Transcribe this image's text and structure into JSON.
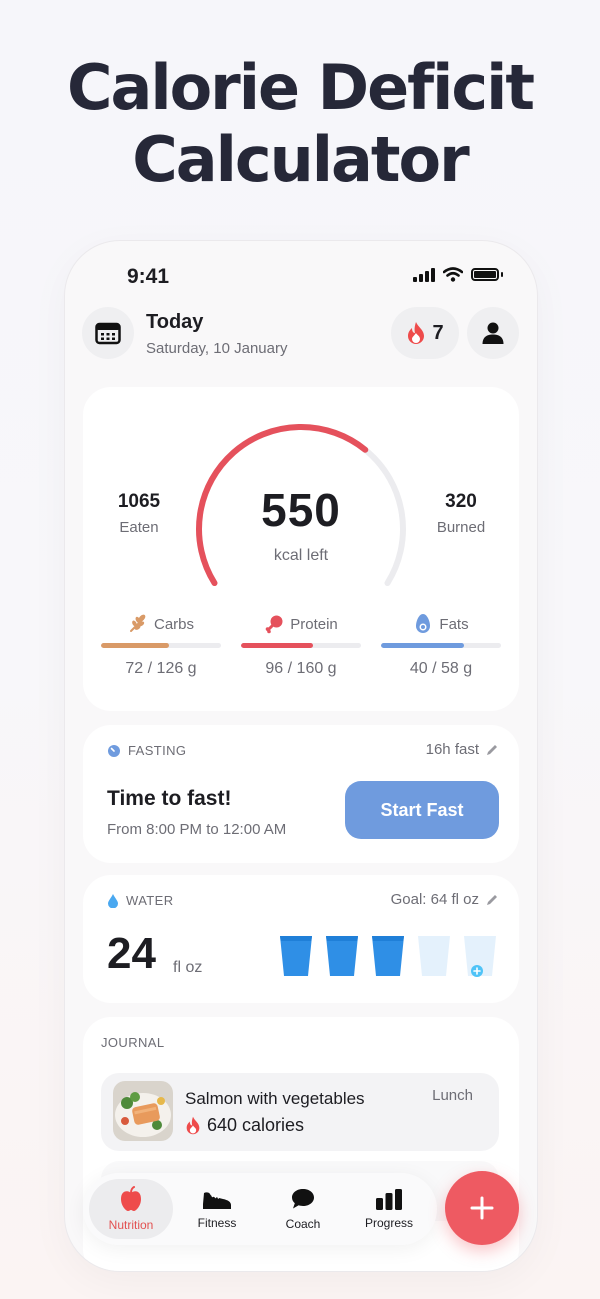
{
  "headline": {
    "line1": "Calorie Deficit",
    "line2": "Calculator"
  },
  "status_bar": {
    "time": "9:41"
  },
  "header": {
    "title": "Today",
    "date": "Saturday, 10 January",
    "streak_count": "7",
    "calendar_icon": "calendar-icon",
    "profile_icon": "user-icon"
  },
  "summary": {
    "eaten_value": "1065",
    "eaten_label": "Eaten",
    "kcal_left": "550",
    "kcal_left_label": "kcal left",
    "burned_value": "320",
    "burned_label": "Burned",
    "ring_progress": 0.66,
    "ring_color": "#e5515c",
    "macros": [
      {
        "name": "Carbs",
        "value": "72 / 126 g",
        "progress": 0.57,
        "color": "#d99a67",
        "icon": "wheat-icon"
      },
      {
        "name": "Protein",
        "value": "96 / 160 g",
        "progress": 0.6,
        "color": "#e5515c",
        "icon": "drumstick-icon"
      },
      {
        "name": "Fats",
        "value": "40 / 58 g",
        "progress": 0.69,
        "color": "#6f9bde",
        "icon": "avocado-icon"
      }
    ]
  },
  "fasting": {
    "section_label": "FASTING",
    "plan": "16h fast",
    "title": "Time to fast!",
    "window": "From 8:00 PM to 12:00 AM",
    "button_label": "Start Fast"
  },
  "water": {
    "section_label": "WATER",
    "goal": "Goal: 64 fl oz",
    "amount": "24",
    "unit": "fl oz",
    "glasses_filled": 3,
    "glasses_total": 5,
    "fill_color": "#2f8fe6"
  },
  "journal": {
    "section_label": "JOURNAL",
    "entries": [
      {
        "name": "Salmon with vegetables",
        "calories": "640 calories",
        "meal": "Lunch"
      }
    ]
  },
  "tabs": [
    {
      "label": "Nutrition",
      "icon": "apple-icon",
      "active": true
    },
    {
      "label": "Fitness",
      "icon": "sneaker-icon",
      "active": false
    },
    {
      "label": "Coach",
      "icon": "chat-icon",
      "active": false
    },
    {
      "label": "Progress",
      "icon": "bar-chart-icon",
      "active": false
    }
  ],
  "accent_color": "#ee5a62"
}
